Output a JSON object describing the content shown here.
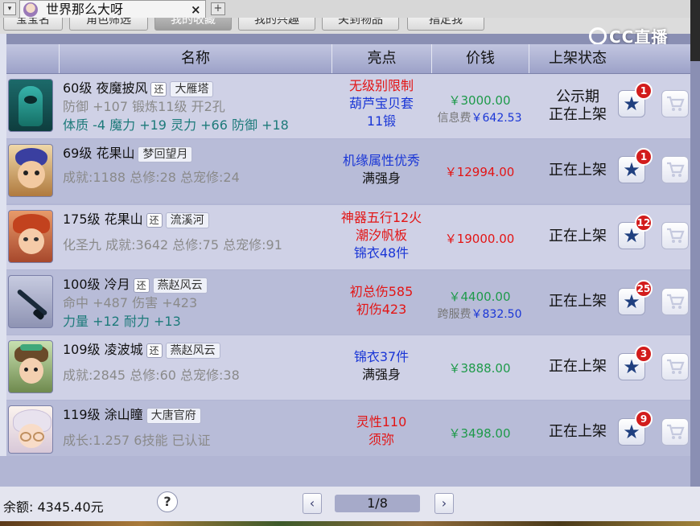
{
  "window": {
    "tab_title": "世界那么大呀",
    "close": "×",
    "new_tab": "+",
    "dropdown": "▾"
  },
  "filters": [
    "宝宝名",
    "角色筛选",
    "我的收藏",
    "我的兴趣",
    "关到物品",
    "指定我"
  ],
  "watermark": "CC直播",
  "headers": {
    "name": "名称",
    "highlight": "亮点",
    "price": "价钱",
    "status": "上架状态"
  },
  "rows": [
    {
      "title": "60级 夜魔披风",
      "huan": "还",
      "server": "大雁塔",
      "stat1": "防御 +107 锻炼11级 开2孔",
      "stat2": "体质 -4 魔力 +19 灵力 +66 防御 +18",
      "highlights": [
        {
          "text": "无级别限制",
          "color": "#e31515"
        },
        {
          "text": "葫芦宝贝套",
          "color": "#1a36d6"
        },
        {
          "text": "11锻",
          "color": "#1a36d6"
        }
      ],
      "price": "￥3000.00",
      "price_color": "#1e9a4a",
      "fee_label": "信息费",
      "fee": "￥642.53",
      "status": [
        "公示期",
        "正在上架"
      ],
      "badge": "1"
    },
    {
      "title": "69级 花果山",
      "server": "梦回望月",
      "stat1": "成就:1188 总修:28 总宠修:24",
      "highlights": [
        {
          "text": "机缘属性优秀",
          "color": "#1a36d6"
        },
        {
          "text": "满强身",
          "color": "#111111"
        }
      ],
      "price": "￥12994.00",
      "price_color": "#e31515",
      "status": [
        "正在上架"
      ],
      "badge": "1"
    },
    {
      "title": "175级 花果山",
      "huan": "还",
      "server": "流溪河",
      "stat1": "化圣九 成就:3642 总修:75 总宠修:91",
      "highlights": [
        {
          "text": "神器五行12火",
          "color": "#e31515"
        },
        {
          "text": "潮汐帆板",
          "color": "#e31515"
        },
        {
          "text": "锦衣48件",
          "color": "#1a36d6"
        }
      ],
      "price": "￥19000.00",
      "price_color": "#e31515",
      "status": [
        "正在上架"
      ],
      "badge": "12"
    },
    {
      "title": "100级 冷月",
      "huan": "还",
      "server": "燕赵风云",
      "stat1": "命中 +487 伤害 +423",
      "stat2": "力量 +12 耐力 +13",
      "highlights": [
        {
          "text": "初总伤585",
          "color": "#e31515"
        },
        {
          "text": "初伤423",
          "color": "#e31515"
        }
      ],
      "price": "￥4400.00",
      "price_color": "#1e9a4a",
      "fee_label": "跨服费",
      "fee": "￥832.50",
      "status": [
        "正在上架"
      ],
      "badge": "25"
    },
    {
      "title": "109级 凌波城",
      "huan": "还",
      "server": "燕赵风云",
      "stat1": "成就:2845 总修:60 总宠修:38",
      "highlights": [
        {
          "text": "锦衣37件",
          "color": "#1a36d6"
        },
        {
          "text": "满强身",
          "color": "#111111"
        }
      ],
      "price": "￥3888.00",
      "price_color": "#1e9a4a",
      "status": [
        "正在上架"
      ],
      "badge": "3"
    },
    {
      "title": "119级 涂山瞳",
      "server": "大唐官府",
      "stat1": "成长:1.257 6技能 已认证",
      "highlights": [
        {
          "text": "灵性110",
          "color": "#e31515"
        },
        {
          "text": "须弥",
          "color": "#e31515"
        }
      ],
      "price": "￥3498.00",
      "price_color": "#1e9a4a",
      "status": [
        "正在上架"
      ],
      "badge": "9"
    }
  ],
  "footer": {
    "balance": "余额: 4345.40元",
    "help": "?",
    "prev": "‹",
    "next": "›",
    "page": "1/8"
  },
  "icons": {
    "star": "star-icon",
    "cart": "cart-icon"
  }
}
